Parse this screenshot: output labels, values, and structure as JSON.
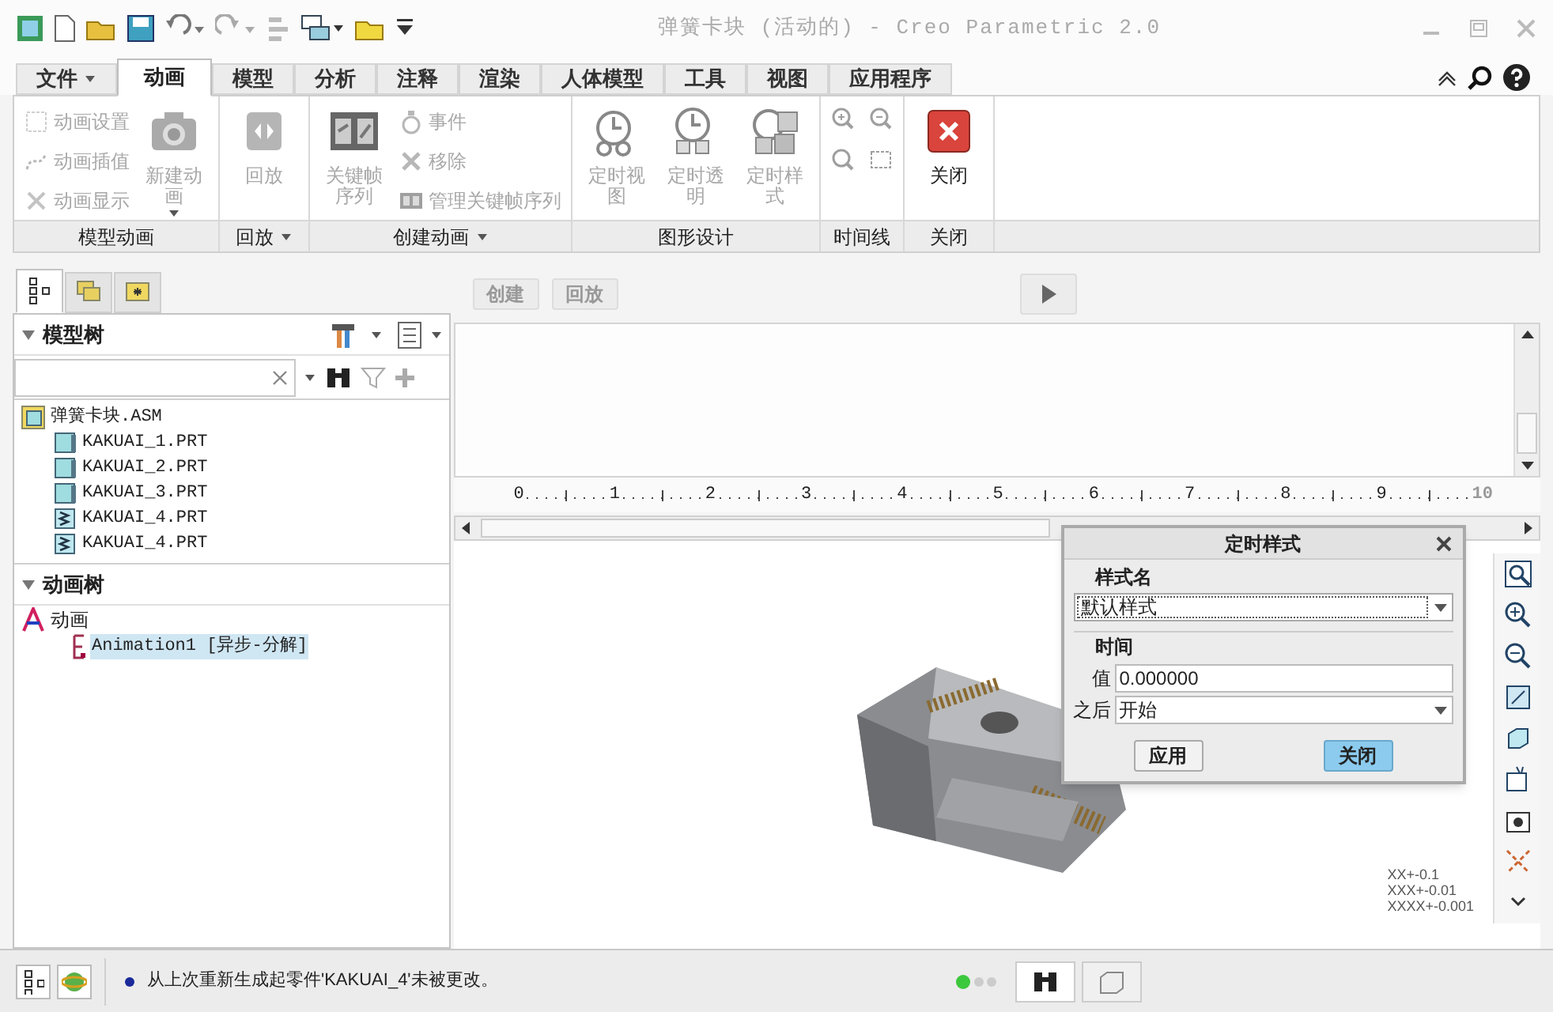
{
  "window": {
    "title": "弹簧卡块 (活动的) - Creo Parametric 2.0"
  },
  "menu_tabs": [
    {
      "label": "文件",
      "selected": false,
      "has_menu": true
    },
    {
      "label": "动画",
      "selected": true
    },
    {
      "label": "模型",
      "selected": false
    },
    {
      "label": "分析",
      "selected": false
    },
    {
      "label": "注释",
      "selected": false
    },
    {
      "label": "渲染",
      "selected": false
    },
    {
      "label": "人体模型",
      "selected": false
    },
    {
      "label": "工具",
      "selected": false
    },
    {
      "label": "视图",
      "selected": false
    },
    {
      "label": "应用程序",
      "selected": false
    }
  ],
  "ribbon_groups": [
    {
      "label": "模型动画",
      "items": [
        {
          "kind": "small",
          "label": "动画设置",
          "disabled": true
        },
        {
          "kind": "small",
          "label": "动画插值",
          "disabled": true
        },
        {
          "kind": "small",
          "label": "动画显示",
          "disabled": true
        },
        {
          "kind": "large",
          "label": "新建动画",
          "disabled": true,
          "has_menu": true
        }
      ]
    },
    {
      "label": "回放",
      "has_menu": true,
      "items": [
        {
          "kind": "large",
          "label": "回放",
          "disabled": true
        }
      ]
    },
    {
      "label": "创建动画",
      "has_menu": true,
      "items": [
        {
          "kind": "large",
          "label": "关键帧序列",
          "disabled": true
        },
        {
          "kind": "small",
          "label": "事件",
          "disabled": true
        },
        {
          "kind": "small",
          "label": "移除",
          "disabled": true
        },
        {
          "kind": "small",
          "label": "管理关键帧序列",
          "disabled": true
        }
      ]
    },
    {
      "label": "图形设计",
      "items": [
        {
          "kind": "large",
          "label": "定时视图",
          "disabled": true
        },
        {
          "kind": "large",
          "label": "定时透明",
          "disabled": true
        },
        {
          "kind": "large",
          "label": "定时样式",
          "disabled": true
        }
      ]
    },
    {
      "label": "时间线",
      "items": [
        {
          "kind": "icon",
          "disabled": true
        },
        {
          "kind": "icon",
          "disabled": true
        },
        {
          "kind": "icon",
          "disabled": true
        },
        {
          "kind": "icon",
          "disabled": true
        }
      ]
    },
    {
      "label": "关闭",
      "items": [
        {
          "kind": "large",
          "label": "关闭",
          "disabled": false
        }
      ]
    }
  ],
  "navigator_tabs": [
    {
      "selected": true
    },
    {
      "selected": false
    },
    {
      "selected": false
    }
  ],
  "model_tree": {
    "title": "模型树",
    "items": [
      {
        "label": "弹簧卡块.ASM",
        "kind": "assembly",
        "children": [
          {
            "label": "KAKUAI_1.PRT",
            "kind": "part"
          },
          {
            "label": "KAKUAI_2.PRT",
            "kind": "part"
          },
          {
            "label": "KAKUAI_3.PRT",
            "kind": "part"
          },
          {
            "label": "KAKUAI_4.PRT",
            "kind": "spring"
          },
          {
            "label": "KAKUAI_4.PRT",
            "kind": "spring"
          }
        ]
      }
    ]
  },
  "animation_tree": {
    "title": "动画树",
    "items": [
      {
        "label": "动画",
        "selected": false,
        "children": [
          {
            "label": "Animation1 [异步-分解]",
            "selected": true
          }
        ]
      }
    ]
  },
  "timeline": {
    "buttons": [
      {
        "label": "创建",
        "disabled": true
      },
      {
        "label": "回放",
        "disabled": true
      }
    ],
    "ruler": [
      "0",
      "1",
      "2",
      "3",
      "4",
      "5",
      "6",
      "7",
      "8",
      "9",
      "10"
    ]
  },
  "dialog": {
    "title": "定时样式",
    "style_section": "样式名",
    "style_value": "默认样式",
    "time_section": "时间",
    "fields": [
      {
        "kind": "text",
        "label": "值",
        "value": "0.000000"
      },
      {
        "kind": "dropdown",
        "label": "之后",
        "value": "开始"
      }
    ],
    "buttons": [
      {
        "label": "应用",
        "primary": false
      },
      {
        "label": "关闭",
        "primary": true
      }
    ]
  },
  "tolerances": [
    "XX+-0.1",
    "XXX+-0.01",
    "XXXX+-0.001"
  ],
  "status_bar": {
    "message": "从上次重新生成起零件'KAKUAI_4'未被更改。",
    "regen_on": true
  }
}
